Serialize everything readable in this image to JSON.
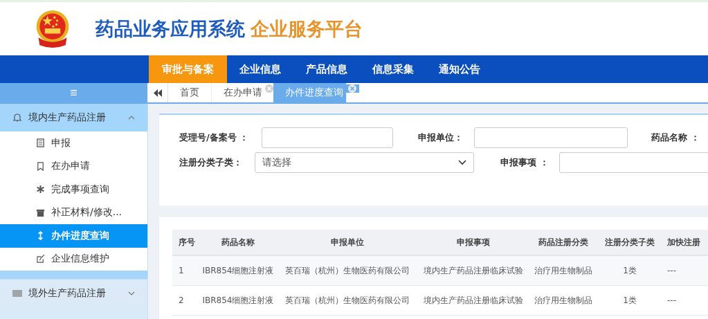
{
  "header": {
    "title": "药品业务应用系统",
    "subtitle": "企业服务平台"
  },
  "nav": [
    {
      "label": "审批与备案",
      "selected": true
    },
    {
      "label": "企业信息",
      "selected": false
    },
    {
      "label": "产品信息",
      "selected": false
    },
    {
      "label": "信息采集",
      "selected": false
    },
    {
      "label": "通知公告",
      "selected": false
    }
  ],
  "tabs": [
    {
      "label": "首页",
      "selected": false,
      "closable": false
    },
    {
      "label": "在办申请",
      "selected": false,
      "closable": true
    },
    {
      "label": "办件进度查询",
      "selected": true,
      "closable": true
    }
  ],
  "sidebar": {
    "menu_toggle": "≡",
    "groups": [
      {
        "label": "境内生产药品注册",
        "expanded": true,
        "children": [
          {
            "label": "申报",
            "selected": false
          },
          {
            "label": "在办申请",
            "selected": false
          },
          {
            "label": "完成事项查询",
            "selected": false
          },
          {
            "label": "补正材料/修改...",
            "selected": false
          },
          {
            "label": "办件进度查询",
            "selected": true
          },
          {
            "label": "企业信息维护",
            "selected": false
          }
        ]
      },
      {
        "label": "境外生产药品注册",
        "expanded": false
      }
    ]
  },
  "search": {
    "row_1": [
      {
        "label": "受理号/备案号 ：",
        "kind": "input"
      },
      {
        "label": "申报单位：",
        "kind": "input"
      },
      {
        "label": "药品名称 ：",
        "kind": "label"
      }
    ],
    "row_2": [
      {
        "label": "注册分类子类：",
        "kind": "select",
        "value": "请选择"
      },
      {
        "label": "申报事项 ：",
        "kind": "input"
      }
    ]
  },
  "table": {
    "columns": [
      "序号",
      "药品名称",
      "申报单位",
      "申报事项",
      "药品注册分类",
      "注册分类子类",
      "加快注册"
    ],
    "rows": [
      [
        "1",
        "IBR854细胞注射液",
        "英百瑞（杭州）生物医药有限公司",
        "境内生产药品注册临床试验",
        "治疗用生物制品",
        "1类",
        "---"
      ],
      [
        "2",
        "IBR854细胞注射液",
        "英百瑞（杭州）生物医药有限公司",
        "境内生产药品注册临床试验",
        "治疗用生物制品",
        "1类",
        "---"
      ]
    ]
  }
}
